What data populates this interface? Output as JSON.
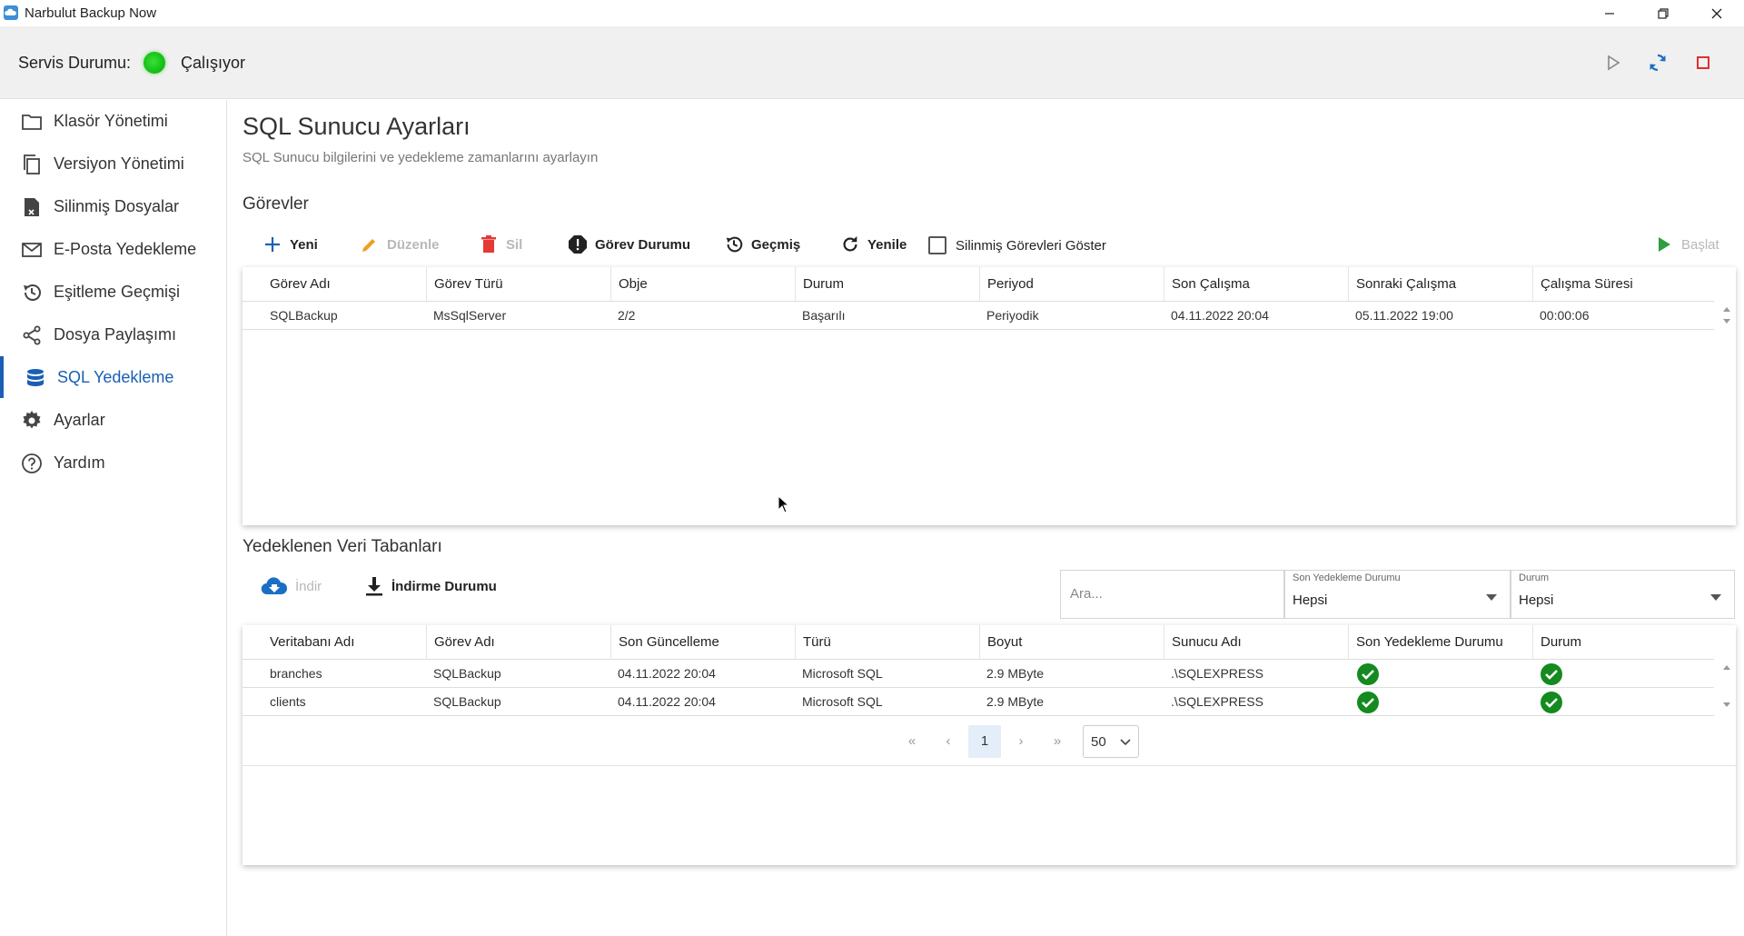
{
  "app": {
    "title": "Narbulut Backup Now"
  },
  "service": {
    "label": "Servis Durumu:",
    "status": "Çalışıyor",
    "status_color": "#1ec21e"
  },
  "window_controls": [
    "minimize-icon",
    "restore-icon",
    "close-icon"
  ],
  "service_controls": [
    "play-icon",
    "refresh-icon",
    "stop-icon"
  ],
  "sidebar": {
    "items": [
      {
        "label": "Klasör Yönetimi",
        "icon": "folder-icon"
      },
      {
        "label": "Versiyon Yönetimi",
        "icon": "copy-icon"
      },
      {
        "label": "Silinmiş Dosyalar",
        "icon": "deleted-file-icon"
      },
      {
        "label": "E-Posta Yedekleme",
        "icon": "mail-icon"
      },
      {
        "label": "Eşitleme Geçmişi",
        "icon": "history-icon"
      },
      {
        "label": "Dosya Paylaşımı",
        "icon": "share-icon"
      },
      {
        "label": "SQL Yedekleme",
        "icon": "database-icon",
        "active": true
      },
      {
        "label": "Ayarlar",
        "icon": "gear-icon"
      },
      {
        "label": "Yardım",
        "icon": "help-icon"
      }
    ],
    "accent": "#1a5fb4"
  },
  "page": {
    "title": "SQL Sunucu Ayarları",
    "subtitle": "SQL Sunucu bilgilerini ve yedekleme zamanlarını ayarlayın"
  },
  "tasks": {
    "title": "Görevler",
    "toolbar": {
      "new": "Yeni",
      "edit": "Düzenle",
      "delete": "Sil",
      "status": "Görev Durumu",
      "history": "Geçmiş",
      "refresh": "Yenile",
      "show_deleted": "Silinmiş Görevleri Göster",
      "start": "Başlat"
    },
    "columns": [
      "Görev Adı",
      "Görev Türü",
      "Obje",
      "Durum",
      "Periyod",
      "Son Çalışma",
      "Sonraki Çalışma",
      "Çalışma Süresi"
    ],
    "rows": [
      [
        "SQLBackup",
        "MsSqlServer",
        "2/2",
        "Başarılı",
        "Periyodik",
        "04.11.2022 20:04",
        "05.11.2022 19:00",
        "00:00:06"
      ]
    ]
  },
  "databases": {
    "title": "Yedeklenen Veri Tabanları",
    "toolbar": {
      "download": "İndir",
      "download_status": "İndirme Durumu"
    },
    "search_placeholder": "Ara...",
    "filter_last_backup": {
      "label": "Son Yedekleme Durumu",
      "value": "Hepsi"
    },
    "filter_status": {
      "label": "Durum",
      "value": "Hepsi"
    },
    "columns": [
      "Veritabanı Adı",
      "Görev Adı",
      "Son Güncelleme",
      "Türü",
      "Boyut",
      "Sunucu Adı",
      "Son Yedekleme Durumu",
      "Durum"
    ],
    "rows": [
      [
        "branches",
        "SQLBackup",
        "04.11.2022 20:04",
        "Microsoft SQL",
        "2.9 MByte",
        ".\\SQLEXPRESS",
        "ok",
        "ok"
      ],
      [
        "clients",
        "SQLBackup",
        "04.11.2022 20:04",
        "Microsoft SQL",
        "2.9 MByte",
        ".\\SQLEXPRESS",
        "ok",
        "ok"
      ]
    ],
    "pager": {
      "current_page": "1",
      "page_size": "50"
    }
  }
}
